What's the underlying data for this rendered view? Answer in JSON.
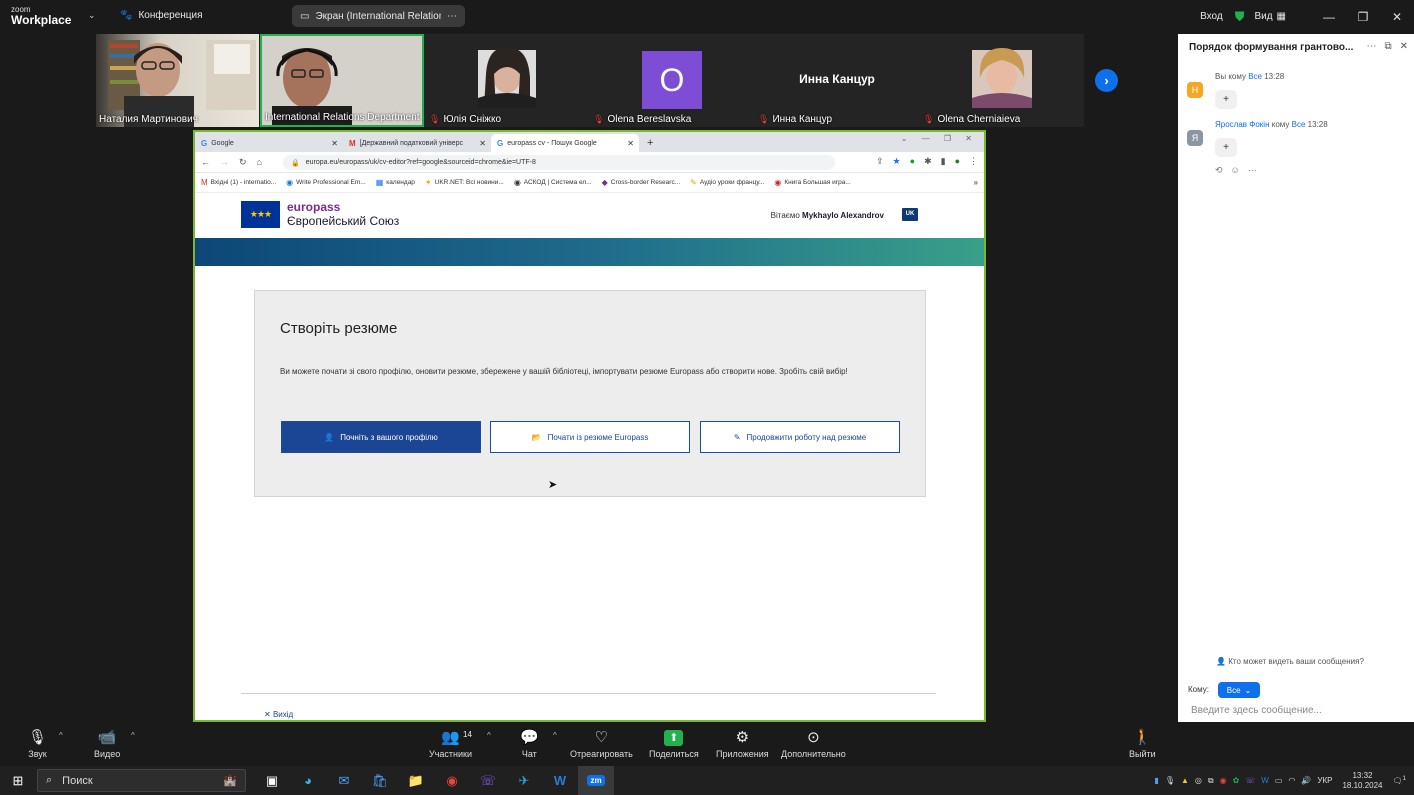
{
  "topbar": {
    "logo_line1": "zoom",
    "logo_line2": "Workplace",
    "conference_label": "Конференция",
    "screen_pill": "Экран (International Relations De",
    "signin": "Вход",
    "view": "Вид"
  },
  "participants": [
    {
      "name": "Наталия Мартинович",
      "muted": false
    },
    {
      "name": "International Relations Department ...",
      "muted": false
    },
    {
      "name": "Юлія Сніжко",
      "muted": true
    },
    {
      "name": "Olena Bereslavska",
      "muted": true,
      "initial": "O"
    },
    {
      "name": "Инна Канцур",
      "muted": true,
      "display_text": "Инна Канцур"
    },
    {
      "name": "Olena Cherniaieva",
      "muted": true
    }
  ],
  "browser": {
    "tabs": [
      {
        "label": "Google"
      },
      {
        "label": "[Державний податковий універс"
      },
      {
        "label": "europass cv - Пошук Google"
      }
    ],
    "url": "europa.eu/europass/uk/cv-editor?ref=google&sourceid=chrome&ie=UTF-8",
    "bookmarks": [
      "Вхідні (1) - internatio...",
      "Write Professional Em...",
      "календар",
      "UKR.NET: Всі новини...",
      "АСКОД | Система ел...",
      "Cross-border Researc...",
      "Аудіо уроки францу...",
      "Книга Большая игра..."
    ]
  },
  "europass": {
    "brand": "europass",
    "subtitle": "Європейський Союз",
    "welcome_prefix": "Вітаємо",
    "user_name": "Mykhaylo Alexandrov",
    "lang": "UK",
    "card_title": "Створіть резюме",
    "card_desc": "Ви можете почати зі свого профілю, оновити резюме, збережене у вашій бібліотеці, імпортувати резюме Europass або створити нове. Зробіть свій вибір!",
    "btn_profile": "Почніть з вашого профілю",
    "btn_europass": "Почати із резюме Europass",
    "btn_continue": "Продовжити роботу над резюме",
    "exit": "Вихід"
  },
  "chat": {
    "header": "Порядок формування грантово...",
    "messages": [
      {
        "avatar": "Н",
        "avatar_color": "#f5a623",
        "sender": "Вы",
        "to_word": "кому",
        "to": "Все",
        "time": "13:28",
        "reaction": "+"
      },
      {
        "avatar": "Я",
        "avatar_color": "#8a96a3",
        "sender": "Ярослав Фокін",
        "to_word": "кому",
        "to": "Все",
        "time": "13:28",
        "reaction": "+"
      }
    ],
    "who_sees": "Кто может видеть ваши сообщения?",
    "to_label": "Кому:",
    "to_value": "Все",
    "input_placeholder": "Введите здесь сообщение..."
  },
  "controls": {
    "audio": "Звук",
    "video": "Видео",
    "participants": "Участники",
    "participants_count": "14",
    "chat": "Чат",
    "react": "Отреагировать",
    "share": "Поделиться",
    "apps": "Приложения",
    "more": "Дополнительно",
    "leave": "Выйти"
  },
  "taskbar": {
    "search": "Поиск",
    "lang": "УКР",
    "time": "13:32",
    "date": "18.10.2024",
    "notifications": "1"
  },
  "colors": {
    "zoom_blue": "#0e71eb",
    "europass_blue": "#1b4595",
    "share_border": "#7ab928",
    "share_green": "#23b14d"
  }
}
